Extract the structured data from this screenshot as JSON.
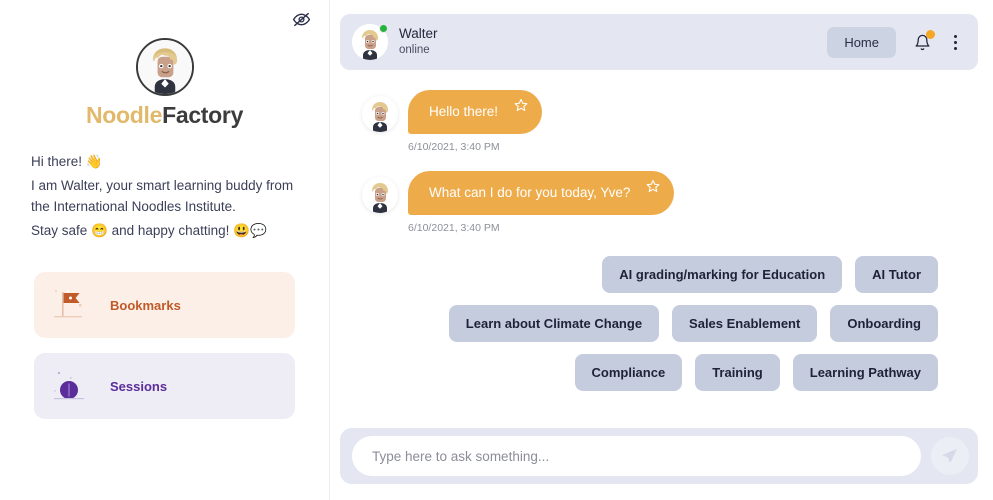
{
  "sidebar": {
    "hide_icon": "eye-off-icon",
    "brand": {
      "avatar_icon": "walter-avatar",
      "name_part1": "Noodle",
      "name_part2": "Factory"
    },
    "greeting": {
      "line1": "Hi there! 👋",
      "line2": "I am Walter, your smart learning buddy from the International Noodles Institute.",
      "line3": "Stay safe 😁 and happy chatting! 😃💬"
    },
    "nav_cards": [
      {
        "label": "Bookmarks",
        "icon": "flag-icon",
        "bg": "#fbefe7",
        "color": "#c05a28"
      },
      {
        "label": "Sessions",
        "icon": "sphere-icon",
        "bg": "#eeecf5",
        "color": "#5b2d9b"
      }
    ]
  },
  "chat": {
    "header": {
      "avatar_icon": "walter-avatar",
      "name": "Walter",
      "status": "online",
      "status_color": "#25b33a",
      "home_label": "Home",
      "bell_icon": "bell-icon",
      "bell_badge_color": "#f5a623",
      "menu_icon": "kebab-menu-icon"
    },
    "messages": [
      {
        "sender": "Walter",
        "text": "Hello there!",
        "time": "6/10/2021, 3:40 PM",
        "bubble_color": "#eeab4a",
        "star_icon": "star-outline-icon"
      },
      {
        "sender": "Walter",
        "text": "What can I do for you today, Yve?",
        "time": "6/10/2021, 3:40 PM",
        "bubble_color": "#eeab4a",
        "star_icon": "star-outline-icon"
      }
    ],
    "suggestion_rows": [
      [
        "AI grading/marking for Education",
        "AI Tutor"
      ],
      [
        "Learn about Climate Change",
        "Sales Enablement",
        "Onboarding"
      ],
      [
        "Compliance",
        "Training",
        "Learning Pathway"
      ]
    ],
    "composer": {
      "placeholder": "Type here to ask something...",
      "value": "",
      "send_icon": "send-paper-plane-icon"
    }
  }
}
